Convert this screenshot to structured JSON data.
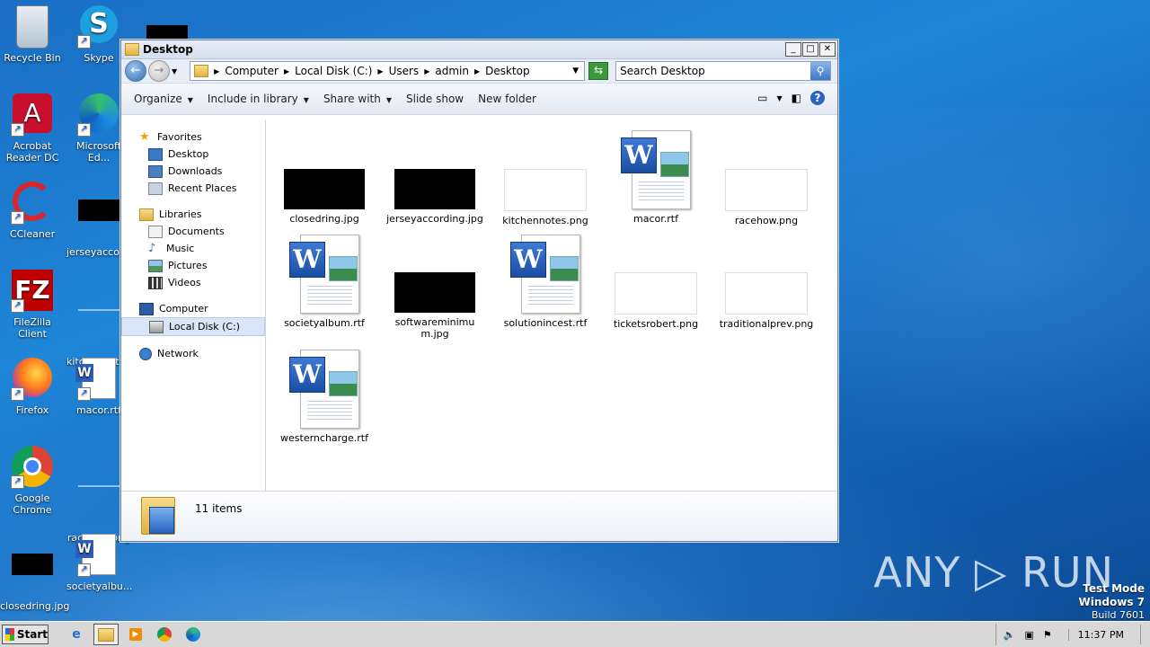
{
  "desktop": {
    "icons": [
      {
        "label": "Recycle Bin",
        "icon": "recycle-bin-icon"
      },
      {
        "label": "Skype",
        "icon": "skype-icon"
      },
      {
        "label": "Acrobat Reader DC",
        "icon": "acrobat-icon"
      },
      {
        "label": "Microsoft Ed...",
        "icon": "edge-icon"
      },
      {
        "label": "CCleaner",
        "icon": "ccleaner-icon"
      },
      {
        "label": "jerseyaccor...",
        "icon": "image-file-icon"
      },
      {
        "label": "FileZilla Client",
        "icon": "filezilla-icon"
      },
      {
        "label": "kitchennote...",
        "icon": "image-file-icon"
      },
      {
        "label": "Firefox",
        "icon": "firefox-icon"
      },
      {
        "label": "macor.rtf",
        "icon": "word-document-icon"
      },
      {
        "label": "Google Chrome",
        "icon": "chrome-icon"
      },
      {
        "label": "racehow.png",
        "icon": "image-file-icon"
      },
      {
        "label": "closedring.jpg",
        "icon": "image-file-icon"
      },
      {
        "label": "societyalbu...",
        "icon": "word-document-icon"
      }
    ]
  },
  "window": {
    "title": "Desktop",
    "controls": {
      "minimize": "_",
      "maximize": "□",
      "close": "✕"
    },
    "address": {
      "crumbs": [
        "Computer",
        "Local Disk (C:)",
        "Users",
        "admin",
        "Desktop"
      ]
    },
    "search": {
      "placeholder": "Search Desktop"
    },
    "toolbar": {
      "organize": "Organize",
      "include": "Include in library",
      "share": "Share with",
      "slideshow": "Slide show",
      "newfolder": "New folder"
    },
    "nav": {
      "favorites": "Favorites",
      "desktop": "Desktop",
      "downloads": "Downloads",
      "recent": "Recent Places",
      "libraries": "Libraries",
      "documents": "Documents",
      "music": "Music",
      "pictures": "Pictures",
      "videos": "Videos",
      "computer": "Computer",
      "localdisk": "Local Disk (C:)",
      "network": "Network"
    },
    "files": [
      {
        "name": "closedring.jpg",
        "type": "black-image"
      },
      {
        "name": "jerseyaccording.jpg",
        "type": "black-image"
      },
      {
        "name": "kitchennotes.png",
        "type": "white-image"
      },
      {
        "name": "macor.rtf",
        "type": "rtf"
      },
      {
        "name": "racehow.png",
        "type": "white-image"
      },
      {
        "name": "societyalbum.rtf",
        "type": "rtf"
      },
      {
        "name": "softwareminimum.jpg",
        "type": "black-image"
      },
      {
        "name": "solutionincest.rtf",
        "type": "rtf"
      },
      {
        "name": "ticketsrobert.png",
        "type": "white-image"
      },
      {
        "name": "traditionalprev.png",
        "type": "white-image"
      },
      {
        "name": "westerncharge.rtf",
        "type": "rtf"
      }
    ],
    "status": {
      "count": "11 items"
    }
  },
  "taskbar": {
    "start": "Start",
    "clock": "11:37 PM"
  },
  "watermark": "ANY ▷ RUN",
  "testmode": {
    "line1": "Test Mode",
    "line2": "Windows 7",
    "line3": "Build 7601"
  }
}
